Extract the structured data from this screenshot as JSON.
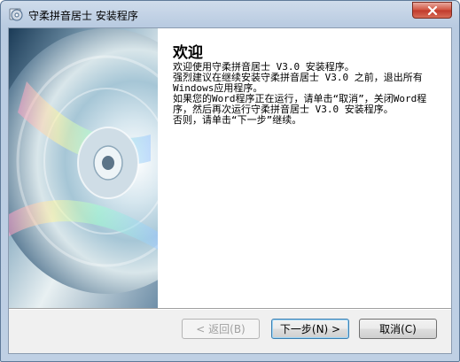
{
  "window": {
    "title": "守柔拼音居士 安装程序"
  },
  "welcome": {
    "heading": "欢迎",
    "paragraphs": [
      "欢迎使用守柔拼音居士 V3.0 安装程序。",
      "强烈建议在继续安装守柔拼音居士 V3.0 之前，退出所有Windows应用程序。",
      "如果您的Word程序正在运行，请单击“取消”，关闭Word程序，然后再次运行守柔拼音居士 V3.0 安装程序。",
      "否则，请单击“下一步”继续。"
    ]
  },
  "buttons": {
    "back": "< 返回(B)",
    "next": "下一步(N) >",
    "cancel": "取消(C)"
  },
  "icons": {
    "title": "setup-disc-icon",
    "close": "close-icon",
    "banner": "cd-disc-image"
  }
}
